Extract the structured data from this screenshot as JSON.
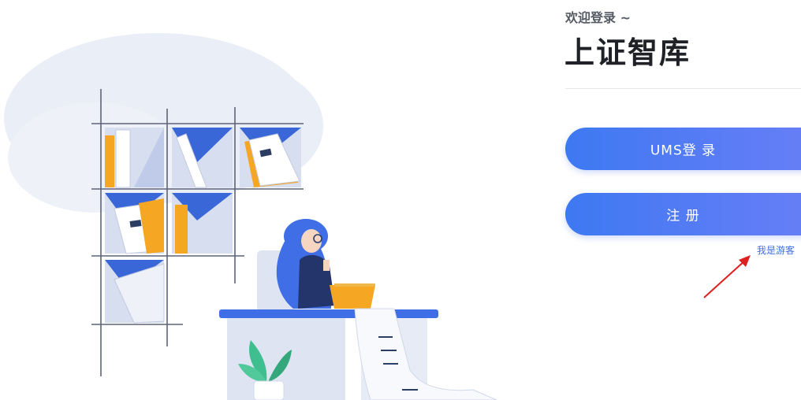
{
  "login_panel": {
    "welcome": "欢迎登录 ~",
    "title": "上证智库",
    "ums_login_label": "UMS登 录",
    "register_label": "注 册",
    "guest_link": "我是游客"
  },
  "colors": {
    "primary_gradient_start": "#3d79f2",
    "primary_gradient_end": "#6a7ff7",
    "annotation_arrow": "#e02020"
  },
  "icons": {
    "illustration": "woman-reading-at-desk-with-bookshelf",
    "annotation": "red-arrow"
  }
}
